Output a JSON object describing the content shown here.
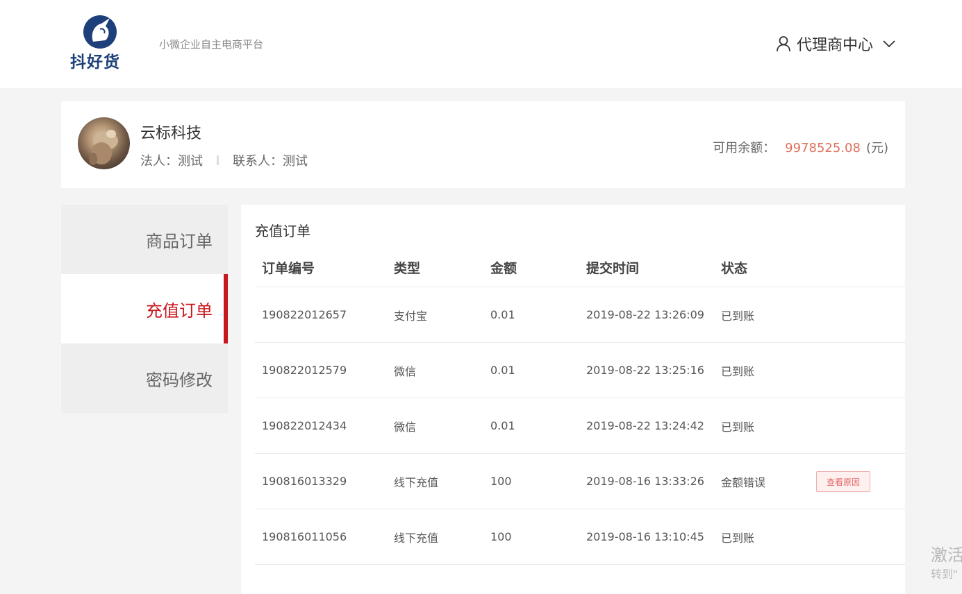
{
  "header": {
    "logo_text": "抖好货",
    "slogan": "小微企业自主电商平台",
    "user_center_label": "代理商中心",
    "brand_color": "#1d3f7a"
  },
  "profile": {
    "company_name": "云标科技",
    "legal_person": "法人：测试",
    "contact_person": "联系人：测试",
    "balance_label": "可用余额：",
    "balance_amount": "9978525.08",
    "balance_unit": "(元)",
    "balance_color": "#e0705a"
  },
  "sidebar": {
    "items": [
      {
        "label": "商品订单",
        "active": false
      },
      {
        "label": "充值订单",
        "active": true
      },
      {
        "label": "密码修改",
        "active": false
      }
    ],
    "active_color": "#c8161d"
  },
  "main": {
    "title": "充值订单",
    "columns": [
      "订单编号",
      "类型",
      "金额",
      "提交时间",
      "状态"
    ],
    "rows": [
      {
        "order_no": "190822012657",
        "type": "支付宝",
        "amount": "0.01",
        "time": "2019-08-22 13:26:09",
        "status": "已到账"
      },
      {
        "order_no": "190822012579",
        "type": "微信",
        "amount": "0.01",
        "time": "2019-08-22 13:25:16",
        "status": "已到账"
      },
      {
        "order_no": "190822012434",
        "type": "微信",
        "amount": "0.01",
        "time": "2019-08-22 13:24:42",
        "status": "已到账"
      },
      {
        "order_no": "190816013329",
        "type": "线下充值",
        "amount": "100",
        "time": "2019-08-16 13:33:26",
        "status": "金额错误",
        "action": "查看原因"
      },
      {
        "order_no": "190816011056",
        "type": "线下充值",
        "amount": "100",
        "time": "2019-08-16 13:10:45",
        "status": "已到账"
      }
    ]
  },
  "watermark": {
    "line1": "激活",
    "line2": "转到\""
  }
}
